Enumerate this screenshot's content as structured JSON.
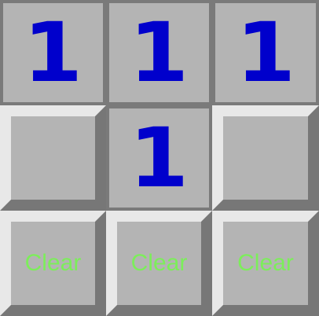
{
  "board": {
    "colors": {
      "number": "#0000cc",
      "clear_label": "#7cee5a",
      "cell_face": "#b4b4b4",
      "bevel_light": "#e8e8e8",
      "bevel_dark": "#777777"
    },
    "cells": [
      {
        "row": 1,
        "col": 1,
        "state": "revealed",
        "text": "1"
      },
      {
        "row": 1,
        "col": 2,
        "state": "revealed",
        "text": "1"
      },
      {
        "row": 1,
        "col": 3,
        "state": "revealed",
        "text": "1"
      },
      {
        "row": 2,
        "col": 1,
        "state": "hidden",
        "text": ""
      },
      {
        "row": 2,
        "col": 2,
        "state": "revealed",
        "text": "1"
      },
      {
        "row": 2,
        "col": 3,
        "state": "hidden",
        "text": ""
      },
      {
        "row": 3,
        "col": 1,
        "state": "hidden",
        "text": "Clear"
      },
      {
        "row": 3,
        "col": 2,
        "state": "hidden",
        "text": "Clear"
      },
      {
        "row": 3,
        "col": 3,
        "state": "hidden",
        "text": "Clear"
      }
    ]
  }
}
